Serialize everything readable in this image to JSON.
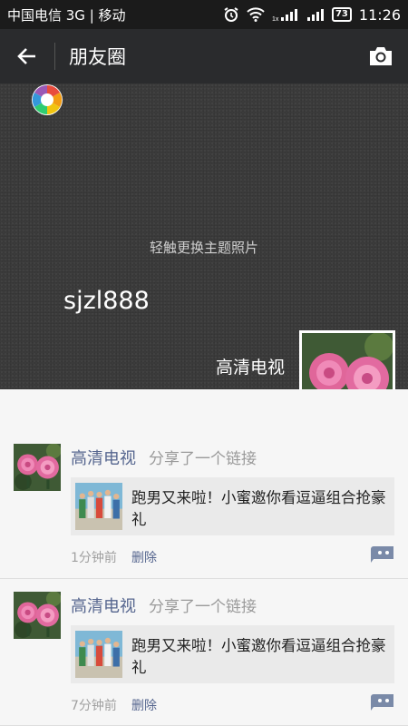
{
  "status_bar": {
    "carrier": "中国电信 3G | 移动",
    "battery": "73",
    "time": "11:26"
  },
  "app_bar": {
    "title": "朋友圈"
  },
  "cover": {
    "hint": "轻触更换主题照片",
    "my_name": "sjzl888",
    "profile_name": "高清电视"
  },
  "posts": [
    {
      "author": "高清电视",
      "action": "分享了一个链接",
      "link_text": "跑男又来啦！小蜜邀你看逗逼组合抢豪礼",
      "time": "1分钟前",
      "delete": "删除"
    },
    {
      "author": "高清电视",
      "action": "分享了一个链接",
      "link_text": "跑男又来啦！小蜜邀你看逗逼组合抢豪礼",
      "time": "7分钟前",
      "delete": "删除"
    }
  ]
}
